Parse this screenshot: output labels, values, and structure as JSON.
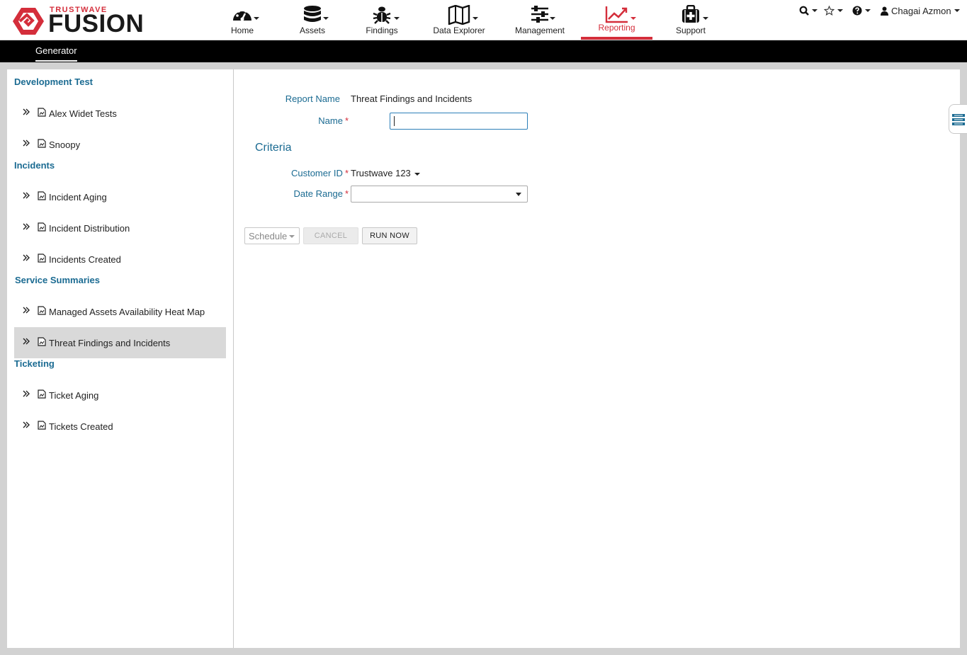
{
  "brand": {
    "top": "TRUSTWAVE",
    "main": "FUSION"
  },
  "nav": [
    {
      "label": "Home",
      "icon": "dashboard-icon"
    },
    {
      "label": "Assets",
      "icon": "database-icon"
    },
    {
      "label": "Findings",
      "icon": "bug-icon"
    },
    {
      "label": "Data Explorer",
      "icon": "map-icon"
    },
    {
      "label": "Management",
      "icon": "sliders-icon"
    },
    {
      "label": "Reporting",
      "icon": "line-chart-icon",
      "active": true
    },
    {
      "label": "Support",
      "icon": "medkit-icon"
    }
  ],
  "utility": {
    "search": "search-icon",
    "favorites": "star-icon",
    "help": "help-icon",
    "user_icon": "user-icon",
    "user_name": "Chagai Azmon"
  },
  "subnav": {
    "tab": "Generator"
  },
  "sidebar": {
    "groups": [
      {
        "title": "Development Test",
        "items": [
          "Alex Widet Tests",
          "Snoopy"
        ]
      },
      {
        "title": "Incidents",
        "items": [
          "Incident Aging",
          "Incident Distribution",
          "Incidents Created"
        ]
      },
      {
        "title": "Service Summaries",
        "items": [
          "Managed Assets Availability Heat Map",
          "Threat Findings and Incidents"
        ]
      },
      {
        "title": "Ticketing",
        "items": [
          "Ticket Aging",
          "Tickets Created"
        ]
      }
    ],
    "selected": "Threat Findings and Incidents"
  },
  "form": {
    "report_name_label": "Report Name",
    "report_name_value": "Threat Findings and Incidents",
    "name_label": "Name",
    "name_value": "",
    "required_mark": "*",
    "criteria_title": "Criteria",
    "customer_id_label": "Customer ID",
    "customer_id_value": "Trustwave 123",
    "date_range_label": "Date Range",
    "date_range_value": ""
  },
  "buttons": {
    "schedule": "Schedule",
    "cancel": "CANCEL",
    "run_now": "RUN NOW"
  },
  "colors": {
    "accent_red": "#d42e3b",
    "link_blue": "#1b6b92",
    "subbar": "#000000"
  }
}
